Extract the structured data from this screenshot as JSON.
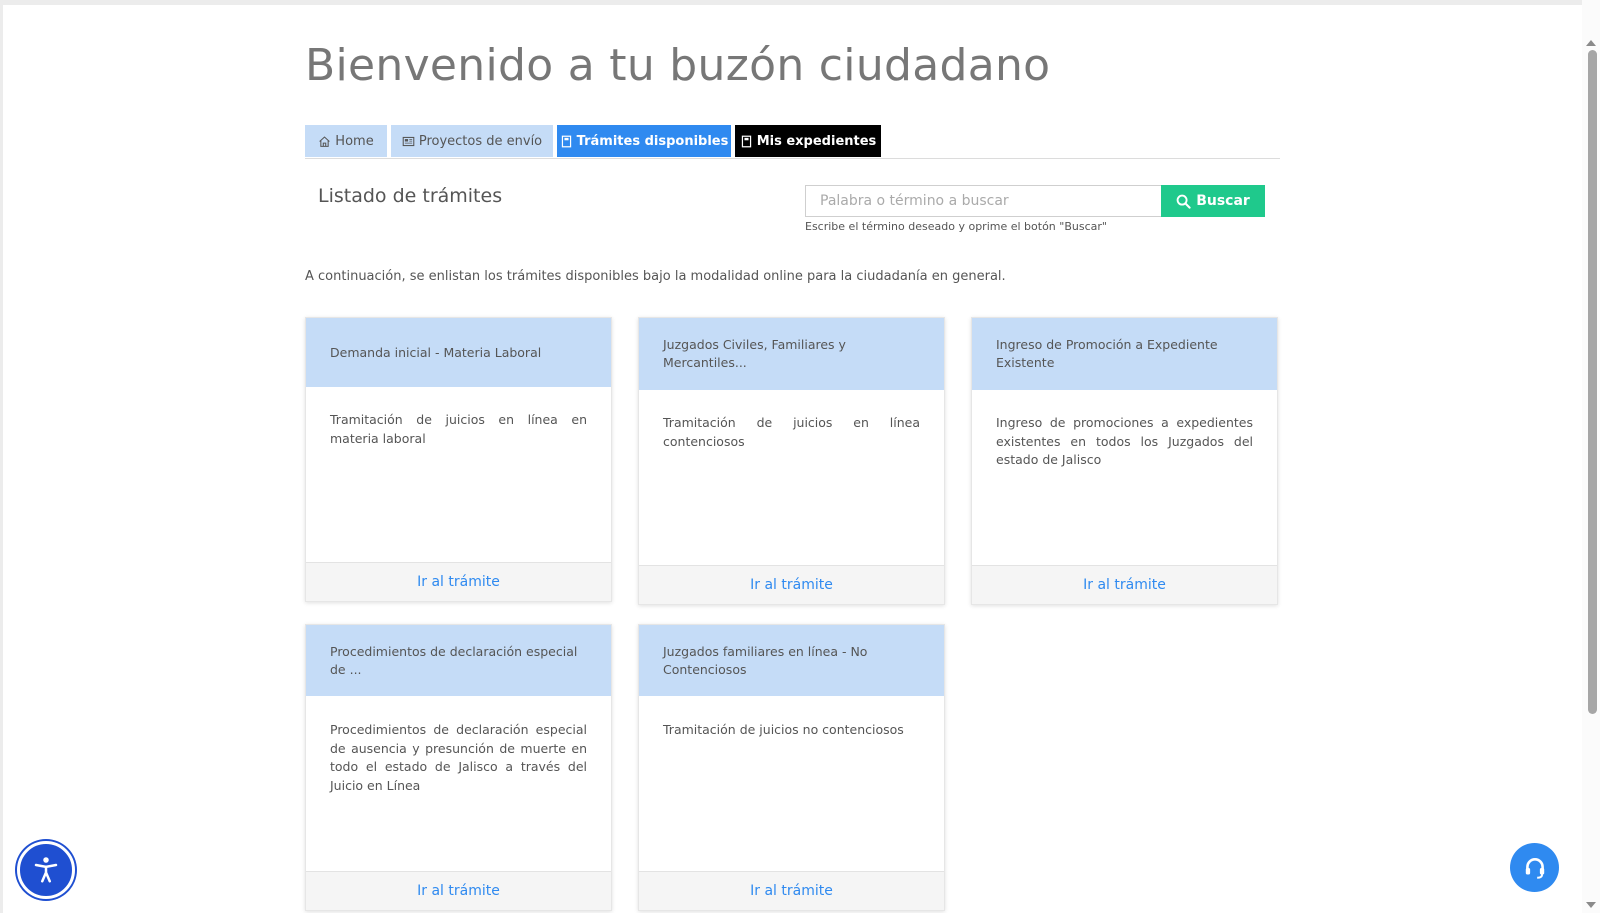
{
  "page": {
    "title": "Bienvenido a tu buzón ciudadano"
  },
  "tabs": [
    {
      "label": "Home",
      "icon": "home-icon"
    },
    {
      "label": "Proyectos de envío",
      "icon": "newspaper-icon"
    },
    {
      "label": "Trámites disponibles",
      "icon": "book-icon",
      "active": true
    },
    {
      "label": "Mis expedientes",
      "icon": "book-icon"
    }
  ],
  "listing": {
    "title": "Listado de trámites",
    "search_placeholder": "Palabra o término a buscar",
    "search_button": "Buscar",
    "search_hint": "Escribe el término deseado y oprime el botón \"Buscar\"",
    "intro": "A continuación, se enlistan los trámites disponibles bajo la modalidad online para la ciudadanía en general."
  },
  "cards": [
    {
      "title": "Demanda inicial - Materia Laboral",
      "description": "Tramitación de juicios en línea en materia laboral",
      "link": "Ir al trámite"
    },
    {
      "title": "Juzgados Civiles, Familiares y Mercantiles...",
      "description": "Tramitación de juicios en línea contenciosos",
      "link": "Ir al trámite"
    },
    {
      "title": "Ingreso de Promoción a Expediente Existente",
      "description": "Ingreso de promociones a expedientes existentes en todos los Juzgados del estado de Jalisco",
      "link": "Ir al trámite"
    },
    {
      "title": "Procedimientos de declaración especial de ...",
      "description": "Procedimientos de declaración especial de ausencia y presunción de muerte en todo el estado de Jalisco a través del Juicio en Línea",
      "link": "Ir al trámite"
    },
    {
      "title": "Juzgados familiares en línea - No Contenciosos",
      "description": "Tramitación de juicios no contenciosos",
      "link": "Ir al trámite"
    }
  ],
  "colors": {
    "tab_inactive": "#c5dcf7",
    "tab_active": "#2f8af0",
    "tab_dark": "#000000",
    "search_button": "#1fc98c",
    "link": "#2f8af0"
  },
  "floating": {
    "accessibility_icon": "accessibility-icon",
    "support_icon": "headset-icon"
  }
}
